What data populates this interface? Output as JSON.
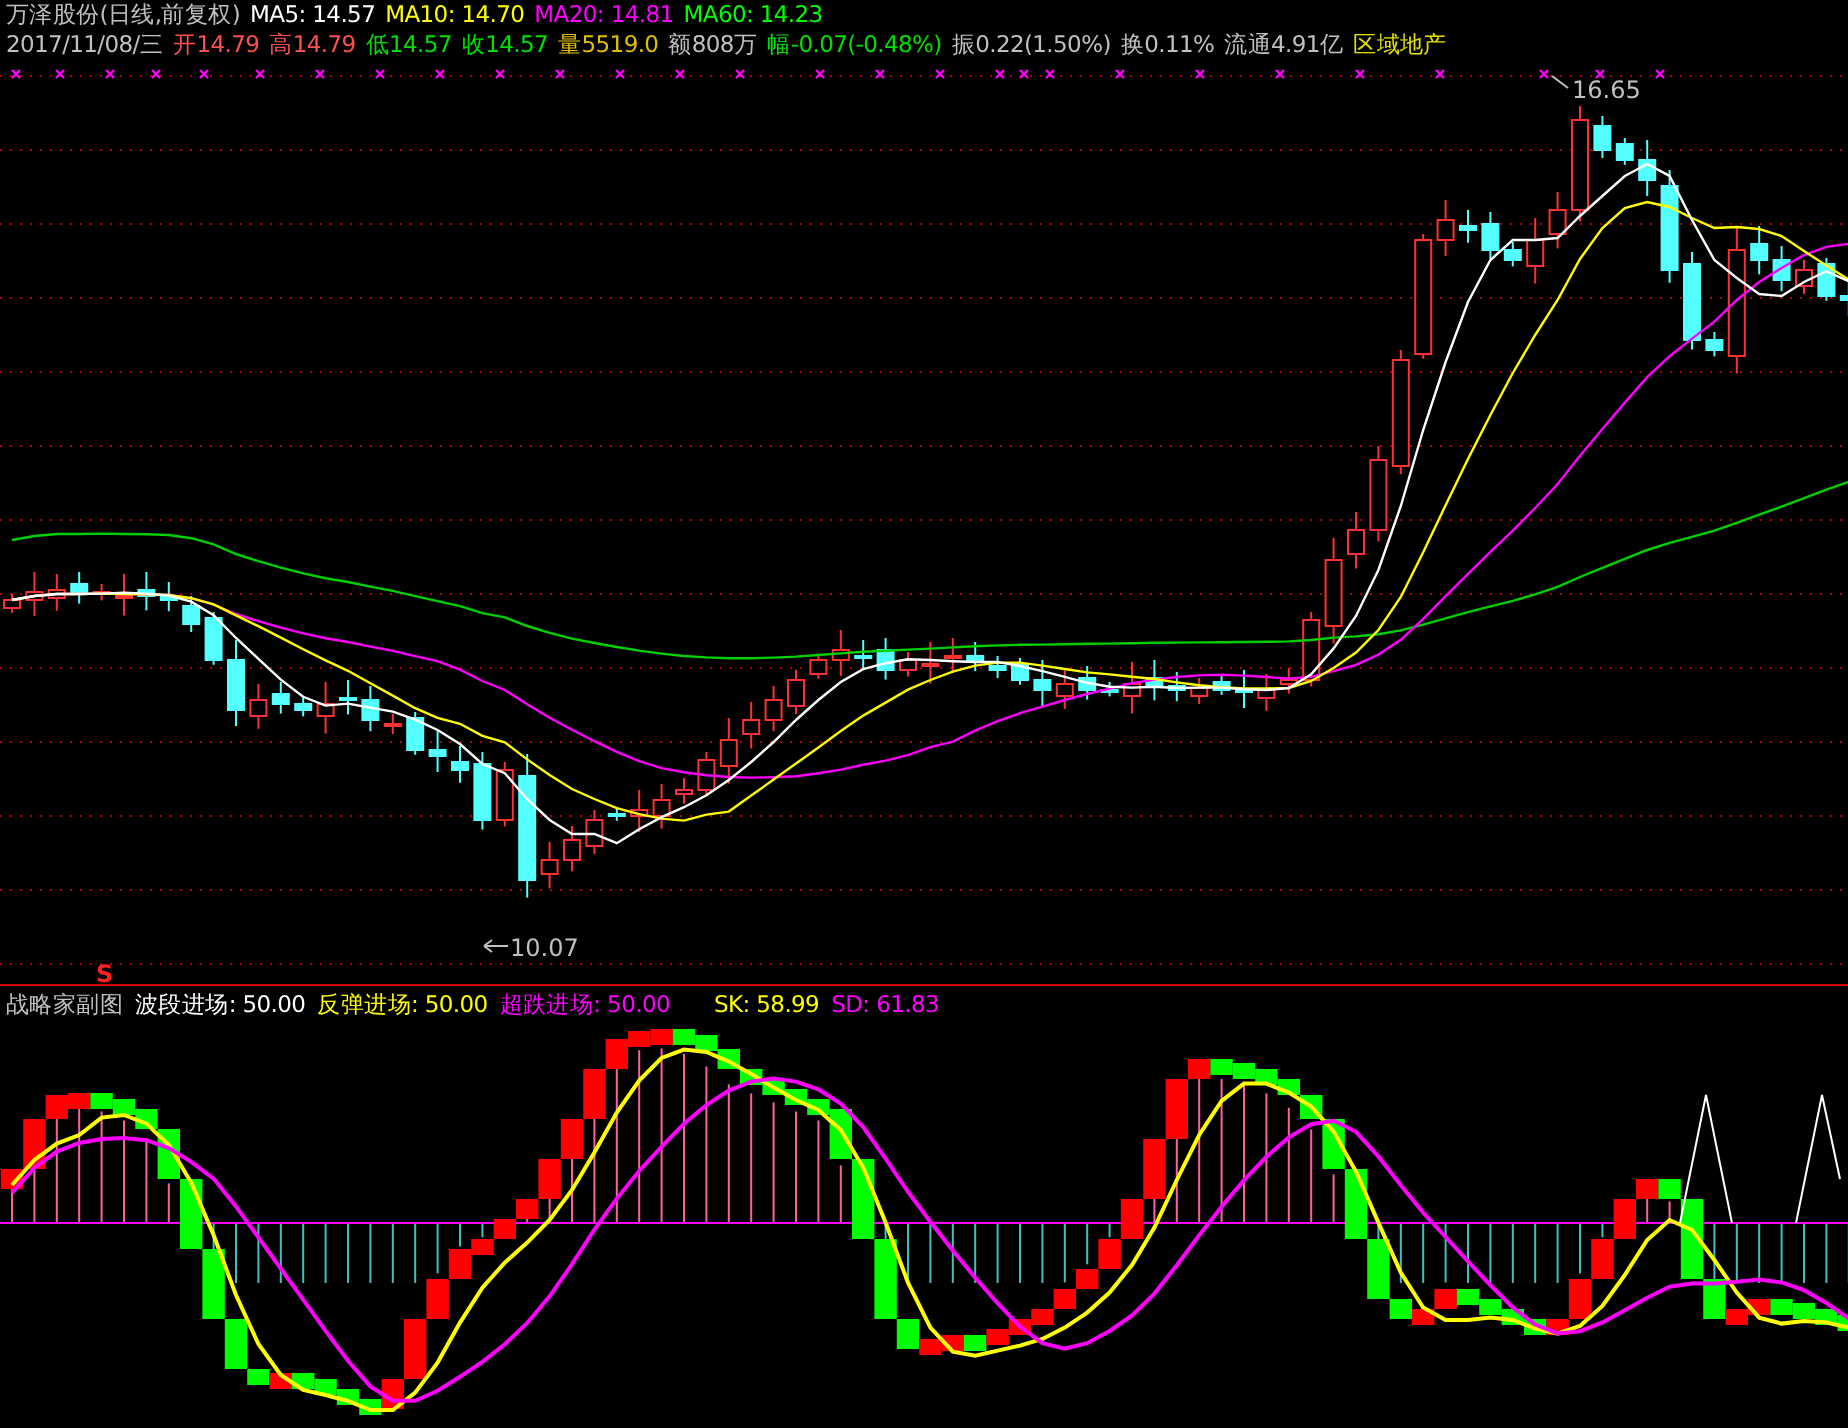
{
  "header": {
    "title": "万泽股份(日线,前复权)",
    "indicators": [
      {
        "text": "MA5: 14.57",
        "color": "#ffffff"
      },
      {
        "text": "MA10: 14.70",
        "color": "#ffff00"
      },
      {
        "text": "MA20: 14.81",
        "color": "#ff00ff"
      },
      {
        "text": "MA60: 14.23",
        "color": "#00ff00"
      }
    ]
  },
  "quote": [
    {
      "text": "2017/11/08/三",
      "color": "#c0c0c0"
    },
    {
      "text": "开14.79",
      "color": "#ff5050"
    },
    {
      "text": "高14.79",
      "color": "#ff5050"
    },
    {
      "text": "低14.57",
      "color": "#00e000"
    },
    {
      "text": "收14.57",
      "color": "#00e000"
    },
    {
      "text": "量5519.0",
      "color": "#e0c000"
    },
    {
      "text": "额808万",
      "color": "#c0c0c0"
    },
    {
      "text": "幅-0.07(-0.48%)",
      "color": "#00e000"
    },
    {
      "text": "振0.22(1.50%)",
      "color": "#c0c0c0"
    },
    {
      "text": "换0.11%",
      "color": "#c0c0c0"
    },
    {
      "text": "流通4.91亿",
      "color": "#c0c0c0"
    },
    {
      "text": "区域地产",
      "color": "#e0e000"
    }
  ],
  "annotations": {
    "high": "16.65",
    "low": "10.07",
    "signal": "S"
  },
  "sub_chart": {
    "title": "战略家副图",
    "indicators": [
      {
        "text": "波段进场: 50.00",
        "color": "#ffffff"
      },
      {
        "text": "反弹进场: 50.00",
        "color": "#ffff00"
      },
      {
        "text": "超跌进场: 50.00",
        "color": "#ff00ff"
      },
      {
        "text": "SK: 58.99",
        "color": "#ffff00"
      },
      {
        "text": "SD: 61.83",
        "color": "#ff00ff"
      }
    ]
  }
}
